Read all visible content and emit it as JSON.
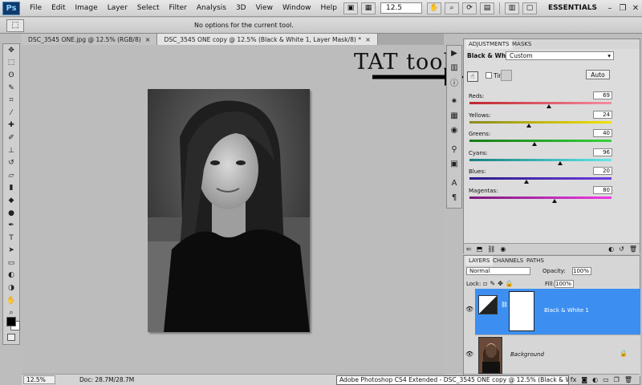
{
  "menubar": {
    "logo": "Ps",
    "items": [
      "File",
      "Edit",
      "Image",
      "Layer",
      "Select",
      "Filter",
      "Analysis",
      "3D",
      "View",
      "Window",
      "Help"
    ],
    "zoom": "12.5",
    "workspace": "ESSENTIALS",
    "window_controls": [
      "–",
      "❐",
      "✕"
    ]
  },
  "options_bar": {
    "message": "No options for the current tool."
  },
  "doc_tabs": [
    {
      "label": "DSC_3545 ONE.jpg @ 12.5% (RGB/8)",
      "close": "×"
    },
    {
      "label": "DSC_3545 ONE copy @ 12.5% (Black & White 1, Layer Mask/8) *",
      "close": "×"
    }
  ],
  "status": {
    "zoom": "12.5%",
    "doc": "Doc: 28.7M/28.7M"
  },
  "annotation": {
    "label": "TAT tool"
  },
  "adjustments": {
    "tabs": [
      "ADJUSTMENTS",
      "MASKS"
    ],
    "title": "Black & White",
    "preset": "Custom",
    "tint_label": "Tint",
    "auto_label": "Auto",
    "sliders": [
      {
        "label": "Reds:",
        "value": "69",
        "pos": 0.56,
        "colors": [
          "#c0262c",
          "#f58ca0"
        ]
      },
      {
        "label": "Yellows:",
        "value": "24",
        "pos": 0.42,
        "colors": [
          "#8a8a22",
          "#f2e200"
        ]
      },
      {
        "label": "Greens:",
        "value": "40",
        "pos": 0.46,
        "colors": [
          "#1a7a1a",
          "#35d23c"
        ]
      },
      {
        "label": "Cyans:",
        "value": "96",
        "pos": 0.64,
        "colors": [
          "#1a7f82",
          "#5fe8e6"
        ]
      },
      {
        "label": "Blues:",
        "value": "20",
        "pos": 0.4,
        "colors": [
          "#2b1a86",
          "#6a3de0"
        ]
      },
      {
        "label": "Magentas:",
        "value": "80",
        "pos": 0.6,
        "colors": [
          "#7a1a7a",
          "#ef3be2"
        ]
      }
    ]
  },
  "layers": {
    "tabs": [
      "LAYERS",
      "CHANNELS",
      "PATHS"
    ],
    "blend_mode": "Normal",
    "opacity_label": "Opacity:",
    "opacity": "100%",
    "lock_label": "Lock:",
    "fill_label": "Fill:",
    "fill": "100%",
    "items": [
      {
        "name": "Black & White 1"
      },
      {
        "name": "Background"
      }
    ]
  },
  "tooltip": "Adobe Photoshop CS4 Extended - DSC_3545 ONE copy @ 12.5% (Black & White 1, Laye"
}
